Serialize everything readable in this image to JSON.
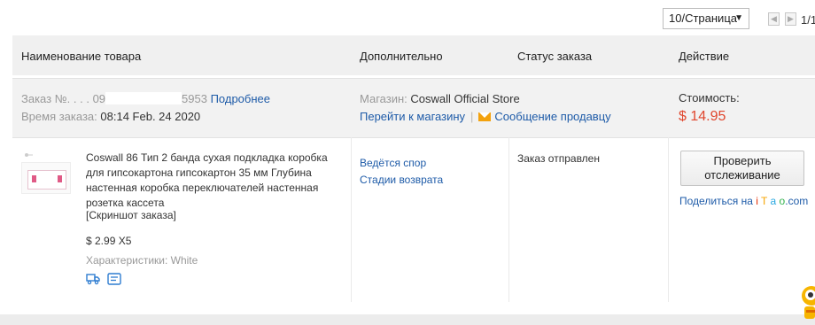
{
  "pager": {
    "page_size": "10/Страница",
    "page_count": "1/1"
  },
  "table_header": {
    "product": "Наименование товара",
    "extra": "Дополнительно",
    "status": "Статус заказа",
    "action": "Действие"
  },
  "order": {
    "number_label": "Заказ №",
    "number_visible_prefix": ". . . . 09",
    "number_suffix": "5953",
    "details_link": "Подробнее",
    "time_label": "Время заказа:",
    "time_value": "08:14 Feb. 24 2020",
    "store_label": "Магазин:",
    "store_name": "Coswall Official Store",
    "go_to_store": "Перейти к магазину",
    "separator": "|",
    "message_seller": "Сообщение продавцу",
    "cost_label": "Стоимость:",
    "cost_value": "$ 14.95"
  },
  "product": {
    "title": "Coswall 86 Тип 2 банда сухая подкладка коробка для гипсокартона гипсокартон 35 мм Глубина настенная коробка переключателей настенная розетка кассета",
    "snapshot": "[Скриншот заказа]",
    "price_qty": "$ 2.99 X5",
    "attributes": "Характеристики: White",
    "dispute_link": "Ведётся спор",
    "return_link": "Стадии возврата",
    "status": "Заказ отправлен",
    "track_button": "Проверить отслеживание",
    "share_prefix": "Поделиться на",
    "share_brand": [
      "i",
      "T",
      "a",
      "o",
      ".com"
    ]
  },
  "colors": {
    "link": "#1e5ba8",
    "price": "#e0462d",
    "header_bg": "#f0f0f0"
  },
  "icons": {
    "shipping": "truck-icon",
    "invoice": "receipt-icon",
    "mail": "mail-icon"
  }
}
